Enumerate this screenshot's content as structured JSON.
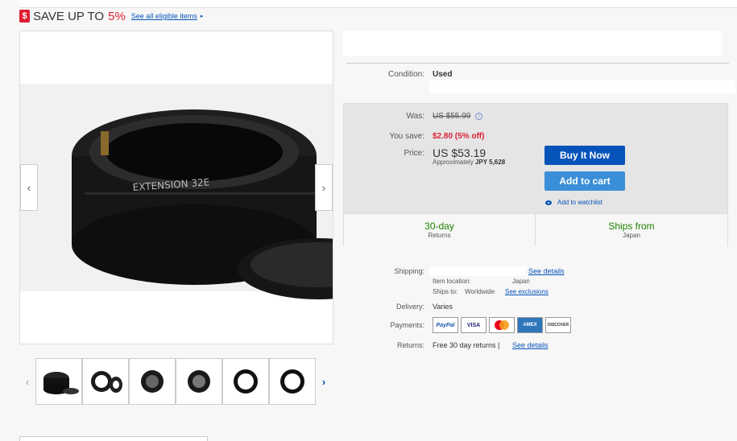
{
  "promo": {
    "prefix": "SAVE UP TO",
    "percent": "5%",
    "link": "See all eligible items",
    "arrow": "▸"
  },
  "gallery": {
    "left_arrow": "‹",
    "right_arrow": "›",
    "product_label": "EXTENSION 32E",
    "thumb_left": "‹",
    "thumb_right": "›",
    "thumb_count": 6
  },
  "condition": {
    "label": "Condition:",
    "value": "Used"
  },
  "price": {
    "was_label": "Was:",
    "was_value": "US $55.99",
    "save_label": "You save:",
    "save_value": "$2.80 (5% off)",
    "price_label": "Price:",
    "price_value": "US $53.19",
    "approx_prefix": "Approximately",
    "approx_value": "JPY 5,628",
    "buy_now": "Buy It Now",
    "add_to_cart": "Add to cart",
    "watch": "Add to watchlist",
    "returns_big": "30-day",
    "returns_small": "Returns",
    "ships_big": "Ships from",
    "ships_small": "Japan"
  },
  "shipping": {
    "label": "Shipping:",
    "see_details": "See details",
    "item_location_label": "Item location:",
    "item_location": "Japan",
    "ships_to_label": "Ships to:",
    "ships_to": "Worldwide",
    "see_exclusions": "See exclusions"
  },
  "delivery": {
    "label": "Delivery:",
    "value": "Varies"
  },
  "payments": {
    "label": "Payments:",
    "icons": [
      "PayPal",
      "VISA",
      "Mastercard",
      "AMEX",
      "DISCOVER"
    ]
  },
  "returns": {
    "label": "Returns:",
    "value": "Free 30 day returns |",
    "link": "See details"
  }
}
